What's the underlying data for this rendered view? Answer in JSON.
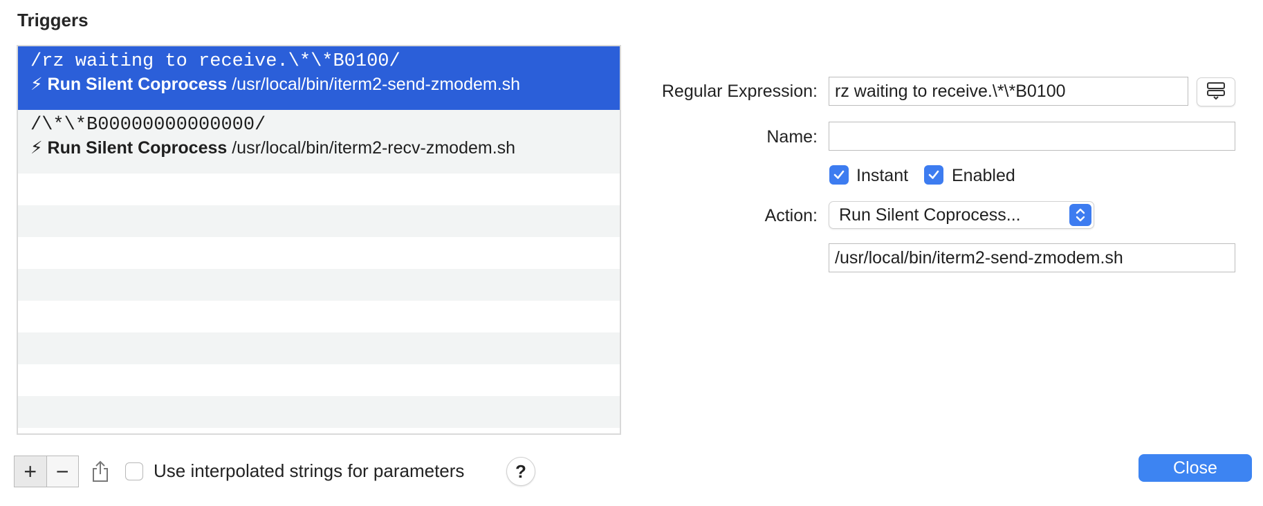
{
  "heading": "Triggers",
  "triggers": [
    {
      "regex": "/rz waiting to receive.\\*\\*B0100/",
      "action_icon": "⚡",
      "action_name": "Run Silent Coprocess",
      "action_param": "/usr/local/bin/iterm2-send-zmodem.sh",
      "selected": true
    },
    {
      "regex": "/\\*\\*B00000000000000/",
      "action_icon": "⚡",
      "action_name": "Run Silent Coprocess",
      "action_param": "/usr/local/bin/iterm2-recv-zmodem.sh",
      "selected": false
    }
  ],
  "toolbar": {
    "add_label": "+",
    "remove_label": "−",
    "share_icon": "share-icon",
    "interpolate_label": "Use interpolated strings for parameters",
    "interpolate_checked": false,
    "help_label": "?"
  },
  "editor": {
    "regex_label": "Regular Expression:",
    "regex_value": "rz waiting to receive.\\*\\*B0100",
    "name_label": "Name:",
    "name_value": "",
    "instant_label": "Instant",
    "instant_checked": true,
    "enabled_label": "Enabled",
    "enabled_checked": true,
    "action_label": "Action:",
    "action_value": "Run Silent Coprocess...",
    "param_value": "/usr/local/bin/iterm2-send-zmodem.sh"
  },
  "close_label": "Close",
  "colors": {
    "selection": "#2b5fd9",
    "accent": "#3d7cf0",
    "close_button": "#3d84f2",
    "stripe": "#f2f4f4"
  }
}
